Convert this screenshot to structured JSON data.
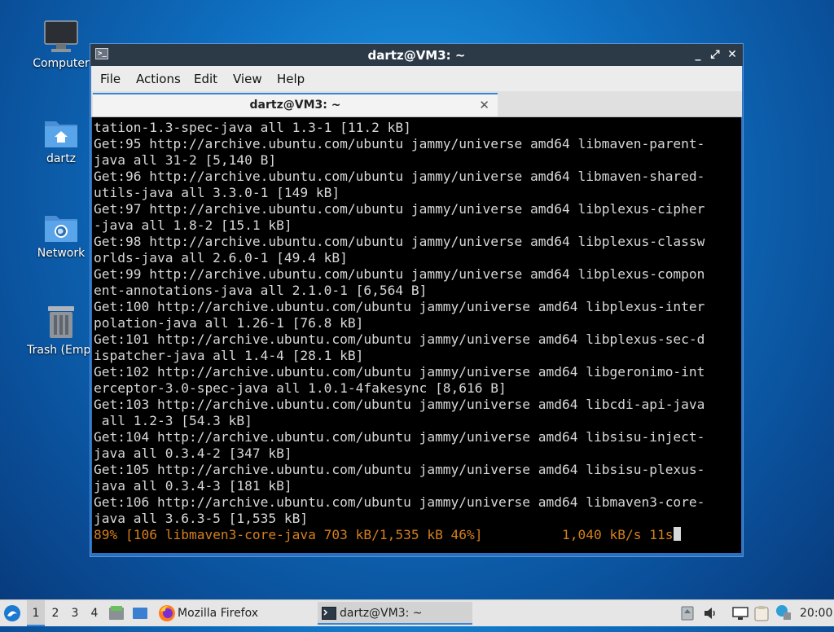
{
  "desktop": {
    "icons": [
      {
        "label": "Computer",
        "icon": "computer-icon"
      },
      {
        "label": "dartz",
        "icon": "home-folder-icon"
      },
      {
        "label": "Network",
        "icon": "network-folder-icon"
      },
      {
        "label": "Trash (Empt",
        "icon": "trash-icon"
      }
    ]
  },
  "window": {
    "title": "dartz@VM3: ~",
    "controls": {
      "minimize": "_",
      "maximize": "⤢",
      "close": "✕"
    },
    "menu": [
      "File",
      "Actions",
      "Edit",
      "View",
      "Help"
    ],
    "tab": {
      "title": "dartz@VM3: ~",
      "close": "✕"
    }
  },
  "terminal": {
    "lines": [
      "tation-1.3-spec-java all 1.3-1 [11.2 kB]",
      "Get:95 http://archive.ubuntu.com/ubuntu jammy/universe amd64 libmaven-parent-",
      "java all 31-2 [5,140 B]",
      "Get:96 http://archive.ubuntu.com/ubuntu jammy/universe amd64 libmaven-shared-",
      "utils-java all 3.3.0-1 [149 kB]",
      "Get:97 http://archive.ubuntu.com/ubuntu jammy/universe amd64 libplexus-cipher",
      "-java all 1.8-2 [15.1 kB]",
      "Get:98 http://archive.ubuntu.com/ubuntu jammy/universe amd64 libplexus-classw",
      "orlds-java all 2.6.0-1 [49.4 kB]",
      "Get:99 http://archive.ubuntu.com/ubuntu jammy/universe amd64 libplexus-compon",
      "ent-annotations-java all 2.1.0-1 [6,564 B]",
      "Get:100 http://archive.ubuntu.com/ubuntu jammy/universe amd64 libplexus-inter",
      "polation-java all 1.26-1 [76.8 kB]",
      "Get:101 http://archive.ubuntu.com/ubuntu jammy/universe amd64 libplexus-sec-d",
      "ispatcher-java all 1.4-4 [28.1 kB]",
      "Get:102 http://archive.ubuntu.com/ubuntu jammy/universe amd64 libgeronimo-int",
      "erceptor-3.0-spec-java all 1.0.1-4fakesync [8,616 B]",
      "Get:103 http://archive.ubuntu.com/ubuntu jammy/universe amd64 libcdi-api-java",
      " all 1.2-3 [54.3 kB]",
      "Get:104 http://archive.ubuntu.com/ubuntu jammy/universe amd64 libsisu-inject-",
      "java all 0.3.4-2 [347 kB]",
      "Get:105 http://archive.ubuntu.com/ubuntu jammy/universe amd64 libsisu-plexus-",
      "java all 0.3.4-3 [181 kB]",
      "Get:106 http://archive.ubuntu.com/ubuntu jammy/universe amd64 libmaven3-core-",
      "java all 3.6.3-5 [1,535 kB]"
    ],
    "progress_line": "89% [106 libmaven3-core-java 703 kB/1,535 kB 46%]          1,040 kB/s 11s"
  },
  "taskbar": {
    "workspaces": [
      "1",
      "2",
      "3",
      "4"
    ],
    "active_workspace": "1",
    "tasks": [
      {
        "label": "Mozilla Firefox",
        "icon": "firefox-icon"
      },
      {
        "label": "dartz@VM3: ~",
        "icon": "terminal-icon"
      }
    ],
    "clock": "20:00"
  },
  "colors": {
    "accent": "#3a86d6",
    "terminal_bg": "#000000",
    "terminal_fg": "#d8d8d8",
    "progress_fg": "#d47f1c",
    "titlebar_bg": "#2c3a48"
  }
}
